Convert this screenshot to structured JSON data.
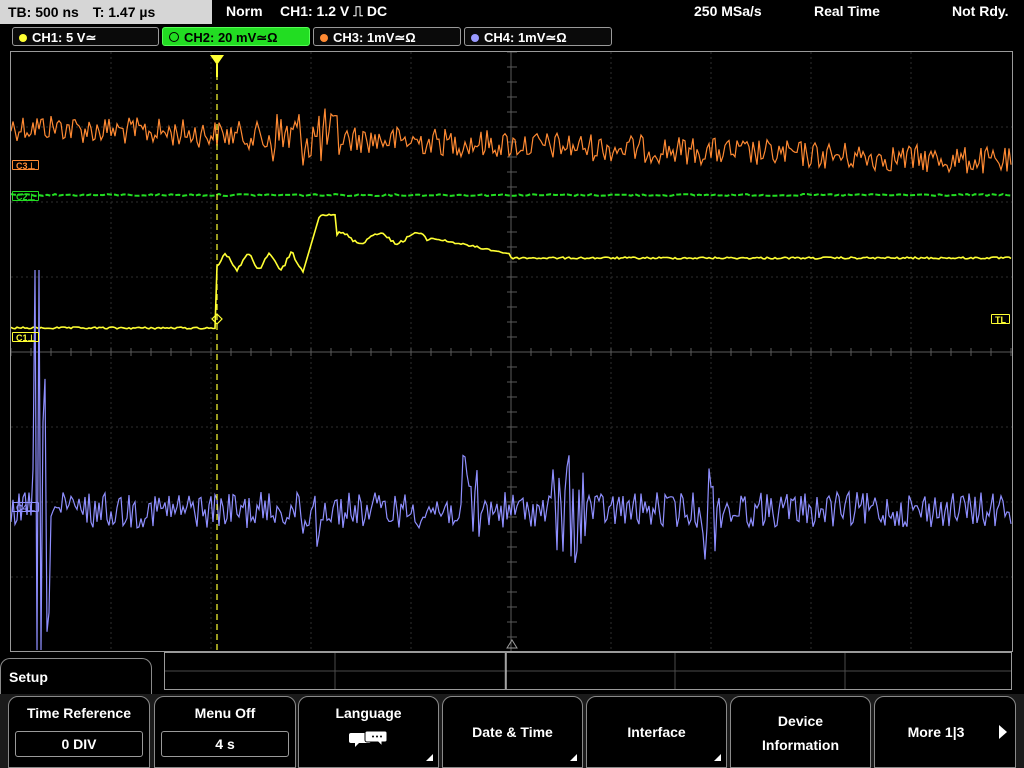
{
  "status": {
    "timebase": "TB: 500 ns",
    "trigger_time": "T: 1.47 µs",
    "acq_mode": "Norm",
    "trigger_setting": "CH1: 1.2 V ⎍ DC",
    "sample_rate": "250 MSa/s",
    "acq_type": "Real Time",
    "state": "Not Rdy."
  },
  "channels": [
    {
      "label": "CH1: 5 V≃",
      "color": "#ffff33",
      "active": false
    },
    {
      "label": "CH2: 20 mV≃Ω",
      "color": "#22dd22",
      "active": true
    },
    {
      "label": "CH3: 1mV≃Ω",
      "color": "#ff8a33",
      "active": false
    },
    {
      "label": "CH4: 1mV≃Ω",
      "color": "#9a9aff",
      "active": false
    }
  ],
  "markers": {
    "c3": "C3⊥",
    "c2": "C2⊥",
    "c1": "C1⊥",
    "c4": "C4⊥",
    "tl": "TL"
  },
  "menu": {
    "title": "Setup",
    "keys": [
      {
        "label": "Time Reference",
        "value": "0 DIV"
      },
      {
        "label": "Menu Off",
        "value": "4 s"
      },
      {
        "label": "Language",
        "icon": "speech-bubble-icon"
      },
      {
        "label": "Date & Time"
      },
      {
        "label": "Interface"
      },
      {
        "label_line1": "Device",
        "label_line2": "Information"
      },
      {
        "label": "More 1|3"
      }
    ]
  },
  "traces": {
    "ch3_color": "#ff8a33",
    "ch2_color": "#22dd22",
    "ch1_color": "#ffff33",
    "ch4_color": "#8f8fff",
    "trigger_color": "#ffff33"
  }
}
